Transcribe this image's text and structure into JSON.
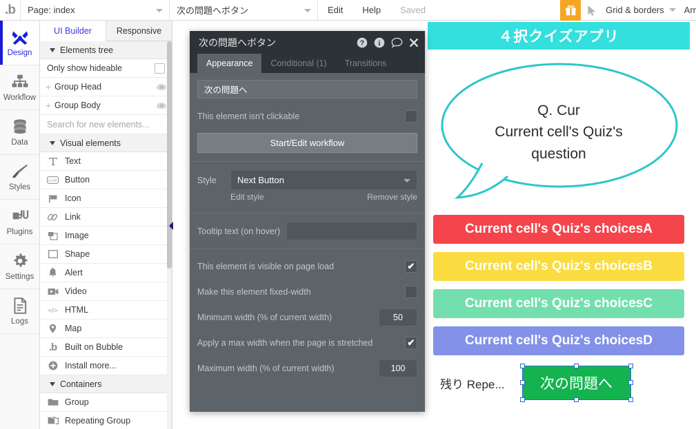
{
  "topbar": {
    "logo": "bubble-logo",
    "page_select": "Page: index",
    "element_select": "次の問題へボタン",
    "menu_edit": "Edit",
    "menu_help": "Help",
    "status_saved": "Saved",
    "gift_icon": "gift-icon",
    "cursor_icon": "cursor-arrow-icon",
    "grid_borders": "Grid & borders",
    "arrange_cut": "Arr",
    "accent_orange": "#f5a623"
  },
  "leftnav": {
    "items": [
      {
        "label": "Design",
        "icon": "design-icon",
        "active": true
      },
      {
        "label": "Workflow",
        "icon": "workflow-icon",
        "active": false
      },
      {
        "label": "Data",
        "icon": "data-icon",
        "active": false
      },
      {
        "label": "Styles",
        "icon": "styles-icon",
        "active": false
      },
      {
        "label": "Plugins",
        "icon": "plugins-icon",
        "active": false
      },
      {
        "label": "Settings",
        "icon": "settings-icon",
        "active": false
      },
      {
        "label": "Logs",
        "icon": "logs-icon",
        "active": false
      }
    ],
    "active_color": "#2c2ce0"
  },
  "elements_panel": {
    "tabs": [
      {
        "label": "UI Builder",
        "active": true
      },
      {
        "label": "Responsive",
        "active": false
      }
    ],
    "elements_tree_header": "Elements tree",
    "only_show_hideable": "Only show hideable",
    "tree_items": [
      {
        "label": "Group Head"
      },
      {
        "label": "Group Body"
      }
    ],
    "search_placeholder": "Search for new elements...",
    "visual_elements_header": "Visual elements",
    "visual_elements": [
      {
        "label": "Text",
        "icon": "text-icon"
      },
      {
        "label": "Button",
        "icon": "button-icon"
      },
      {
        "label": "Icon",
        "icon": "flag-icon"
      },
      {
        "label": "Link",
        "icon": "link-icon"
      },
      {
        "label": "Image",
        "icon": "image-icon"
      },
      {
        "label": "Shape",
        "icon": "shape-icon"
      },
      {
        "label": "Alert",
        "icon": "bell-icon"
      },
      {
        "label": "Video",
        "icon": "video-icon"
      },
      {
        "label": "HTML",
        "icon": "code-icon"
      },
      {
        "label": "Map",
        "icon": "map-pin-icon"
      },
      {
        "label": "Built on Bubble",
        "icon": "bubble-logo-icon"
      },
      {
        "label": "Install more...",
        "icon": "plus-circle-icon"
      }
    ],
    "containers_header": "Containers",
    "containers": [
      {
        "label": "Group",
        "icon": "folder-icon"
      },
      {
        "label": "Repeating Group",
        "icon": "repeating-group-icon"
      }
    ]
  },
  "property_editor": {
    "title": "次の問題へボタン",
    "header_icons": [
      {
        "name": "help-icon"
      },
      {
        "name": "info-icon"
      },
      {
        "name": "comment-icon"
      },
      {
        "name": "close-icon"
      }
    ],
    "tabs": [
      {
        "label": "Appearance",
        "active": true
      },
      {
        "label": "Conditional (1)",
        "active": false
      },
      {
        "label": "Transitions",
        "active": false
      }
    ],
    "button_text_value": "次の問題へ",
    "not_clickable_label": "This element isn't clickable",
    "not_clickable_checked": false,
    "workflow_button": "Start/Edit workflow",
    "style_label": "Style",
    "style_value": "Next Button",
    "edit_style_link": "Edit style",
    "remove_style_link": "Remove style",
    "tooltip_label": "Tooltip text (on hover)",
    "tooltip_value": "",
    "visible_on_load_label": "This element is visible on page load",
    "visible_on_load_checked": true,
    "fixed_width_label": "Make this element fixed-width",
    "fixed_width_checked": false,
    "min_width_label": "Minimum width (% of current width)",
    "min_width_value": "50",
    "max_width_apply_label": "Apply a max width when the page is stretched",
    "max_width_apply_checked": true,
    "max_width_label": "Maximum width (% of current width)",
    "max_width_value": "100"
  },
  "canvas": {
    "app_title": "４択クイズアプリ",
    "header_color": "#33e0de",
    "bubble_border_color": "#2cc6cb",
    "question_prefix": "Q. Cur",
    "question_text": "Current cell's Quiz's question",
    "choices": [
      {
        "label": "Current cell's Quiz's choicesA",
        "color": "#f5444b"
      },
      {
        "label": "Current cell's Quiz's choicesB",
        "color": "#fadc41"
      },
      {
        "label": "Current cell's Quiz's choicesC",
        "color": "#74dfae"
      },
      {
        "label": "Current cell's Quiz's choicesD",
        "color": "#8391e8"
      }
    ],
    "remaining_text": "残り Repe...",
    "next_button_label": "次の問題へ",
    "next_button_color": "#14b350",
    "selection_color": "#2b6ad4"
  }
}
